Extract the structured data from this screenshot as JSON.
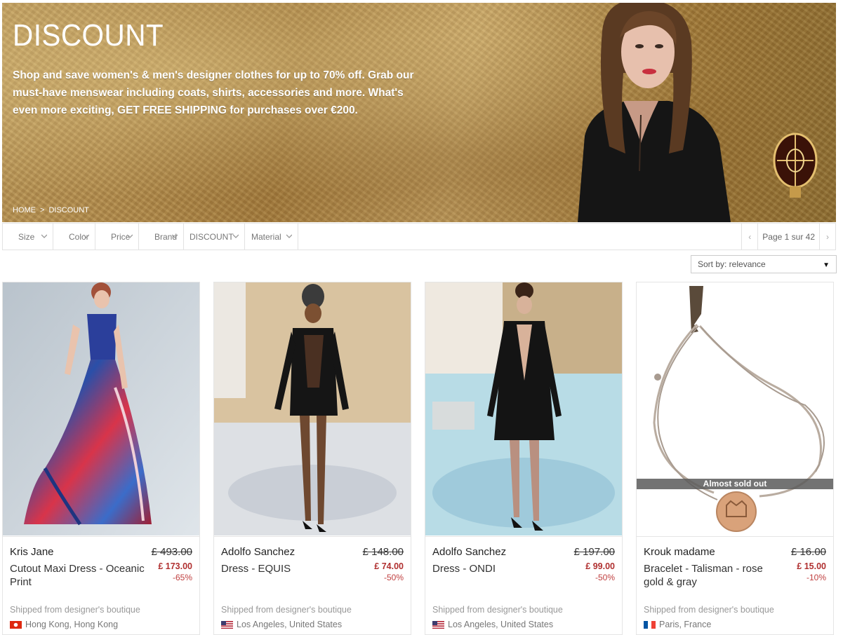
{
  "hero": {
    "title": "DISCOUNT",
    "description": "Shop and save women's & men's designer clothes for up to 70% off. Grab our must-have menswear including coats, shirts, accessories and more. What's even more exciting, GET FREE SHIPPING for purchases over €200.",
    "breadcrumb": {
      "home": "HOME",
      "separator": ">",
      "current": "DISCOUNT"
    }
  },
  "filters": [
    "Size",
    "Color",
    "Price",
    "Brand",
    "DISCOUNT",
    "Material"
  ],
  "pagination": {
    "label": "Page 1 sur 42",
    "prev": "‹",
    "next": "›"
  },
  "sort": {
    "label": "Sort by: relevance",
    "caret": "▼"
  },
  "products": [
    {
      "brand": "Kris Jane",
      "name": "Cutout Maxi Dress - Oceanic Print",
      "old_price": "£ 493.00",
      "price": "£ 173.00",
      "discount": "-65%",
      "shipping": "Shipped from designer's boutique",
      "location": "Hong Kong, Hong Kong",
      "flag": "hong-kong-flag",
      "badge": ""
    },
    {
      "brand": "Adolfo Sanchez",
      "name": "Dress - EQUIS",
      "old_price": "£ 148.00",
      "price": "£ 74.00",
      "discount": "-50%",
      "shipping": "Shipped from designer's boutique",
      "location": "Los Angeles, United States",
      "flag": "us-flag",
      "badge": ""
    },
    {
      "brand": "Adolfo Sanchez",
      "name": "Dress - ONDI",
      "old_price": "£ 197.00",
      "price": "£ 99.00",
      "discount": "-50%",
      "shipping": "Shipped from designer's boutique",
      "location": "Los Angeles, United States",
      "flag": "us-flag",
      "badge": ""
    },
    {
      "brand": "Krouk madame",
      "name": "Bracelet - Talisman - rose gold & gray",
      "old_price": "£ 16.00",
      "price": "£ 15.00",
      "discount": "-10%",
      "shipping": "Shipped from designer's boutique",
      "location": "Paris, France",
      "flag": "france-flag",
      "badge": "Almost sold out"
    }
  ],
  "colors": {
    "accent_price": "#b03030",
    "hero_gold": "#a57d3f",
    "border": "#e2e2e2"
  }
}
